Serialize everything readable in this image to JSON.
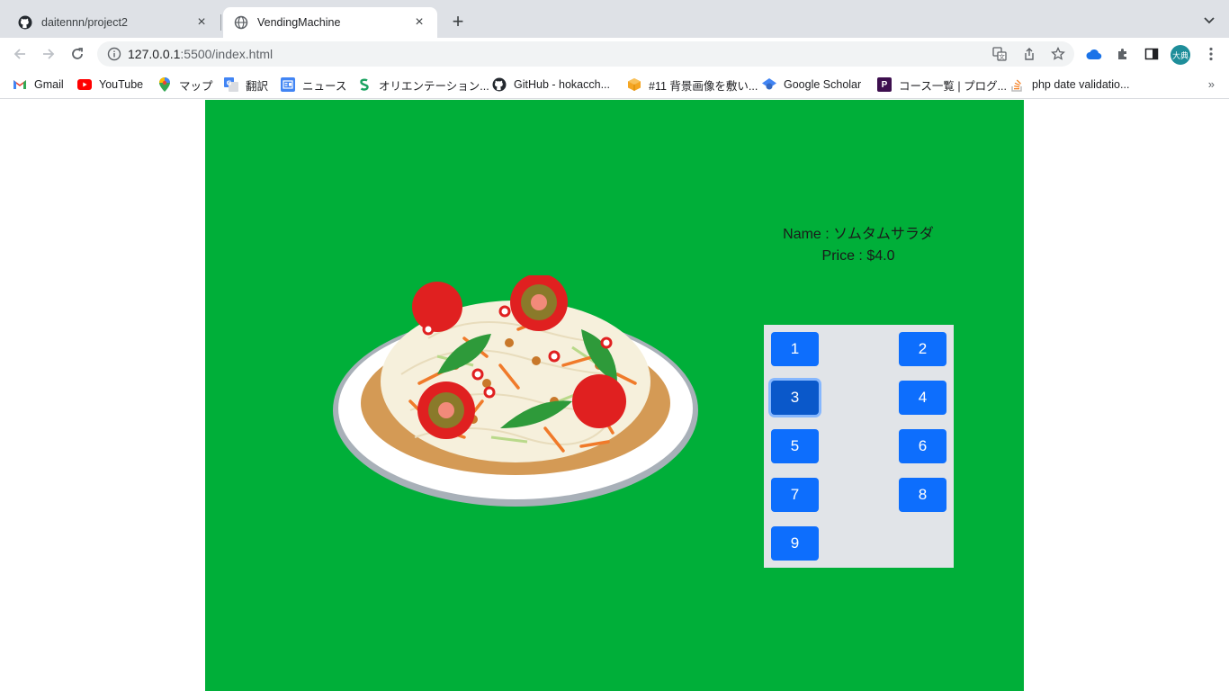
{
  "browser": {
    "tabs": [
      {
        "title": "daitennn/project2",
        "icon": "github-icon"
      },
      {
        "title": "VendingMachine",
        "icon": "globe-icon"
      }
    ],
    "url_host": "127.0.0.1",
    "url_rest": ":5500/index.html",
    "avatar_text": "大典",
    "bookmarks": [
      {
        "label": "Gmail",
        "icon": "gmail-icon"
      },
      {
        "label": "YouTube",
        "icon": "youtube-icon"
      },
      {
        "label": "マップ",
        "icon": "maps-icon"
      },
      {
        "label": "翻訳",
        "icon": "translate-icon"
      },
      {
        "label": "ニュース",
        "icon": "news-icon"
      },
      {
        "label": "オリエンテーション...",
        "icon": "orientation-icon"
      },
      {
        "label": "GitHub - hokacch...",
        "icon": "github-icon"
      },
      {
        "label": "#11 背景画像を敷い...",
        "icon": "box-icon"
      },
      {
        "label": "Google Scholar",
        "icon": "scholar-icon"
      },
      {
        "label": "コース一覧 | プログ...",
        "icon": "progate-icon"
      },
      {
        "label": "php date validatio...",
        "icon": "stackoverflow-icon"
      }
    ],
    "bookmarks_more": "»"
  },
  "vending": {
    "name_line": "Name : ソムタムサラダ",
    "price_line": "Price : $4.0",
    "image_alt": "som-tam-salad",
    "keys": [
      "1",
      "2",
      "3",
      "4",
      "5",
      "6",
      "7",
      "8",
      "9"
    ],
    "selected_key": "3"
  },
  "colors": {
    "machine_bg": "#00af39",
    "keypad_bg": "#e1e4e8",
    "key_bg": "#0d6efd",
    "key_selected_bg": "#0a58ca"
  }
}
